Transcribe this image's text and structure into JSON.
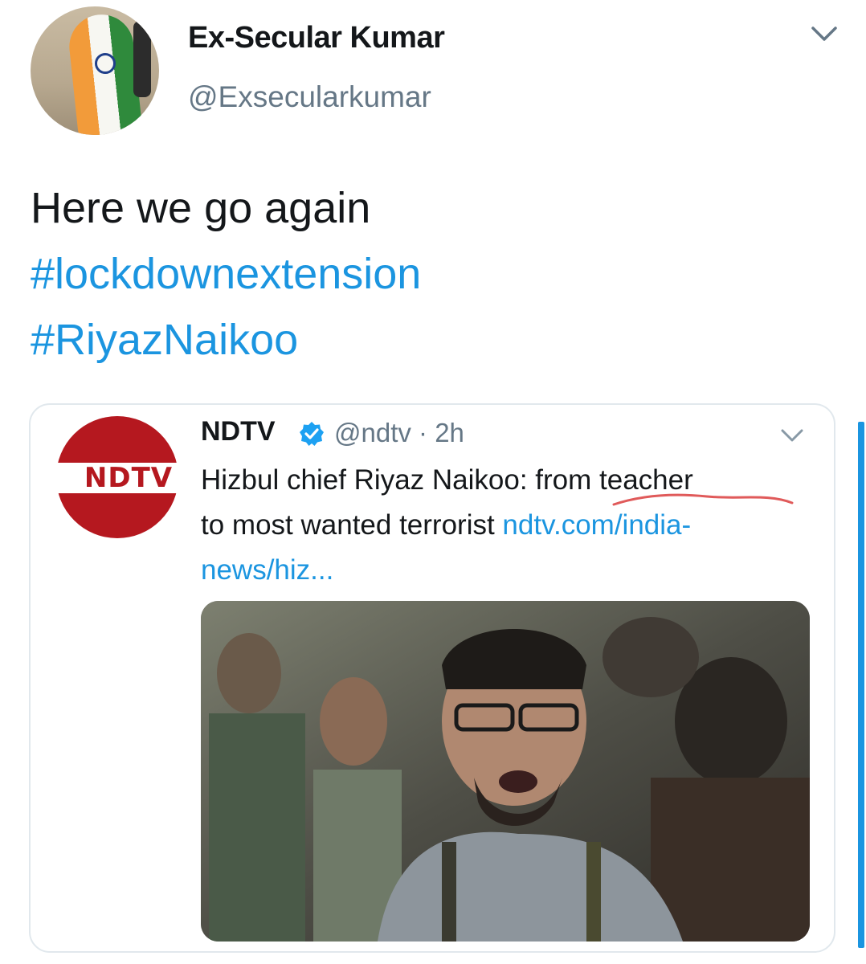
{
  "author": {
    "display_name": "Ex-Secular Kumar",
    "handle": "@Exsecularkumar",
    "avatar_icon": "avatar-flag-person"
  },
  "tweet": {
    "text_line": "Here we go again",
    "hashtags": [
      "#lockdownextension",
      "#RiyazNaikoo"
    ]
  },
  "quoted": {
    "logo_text": "NDTV",
    "name": "NDTV",
    "verified_icon": "verified-badge-icon",
    "handle_time": "@ndtv · 2h",
    "text_line1": "Hizbul chief Riyaz Naikoo: from teacher",
    "text_line2_prefix": "to most wanted terrorist ",
    "link_part1": "ndtv.com/india-",
    "link_part2": "news/hiz...",
    "image_icon": "news-photo-crowd"
  },
  "colors": {
    "link": "#1b95e0",
    "secondary_text": "#657786",
    "ndtv_red": "#b5181f",
    "card_border": "#e1e8ed",
    "scribble": "#e05a5a"
  }
}
